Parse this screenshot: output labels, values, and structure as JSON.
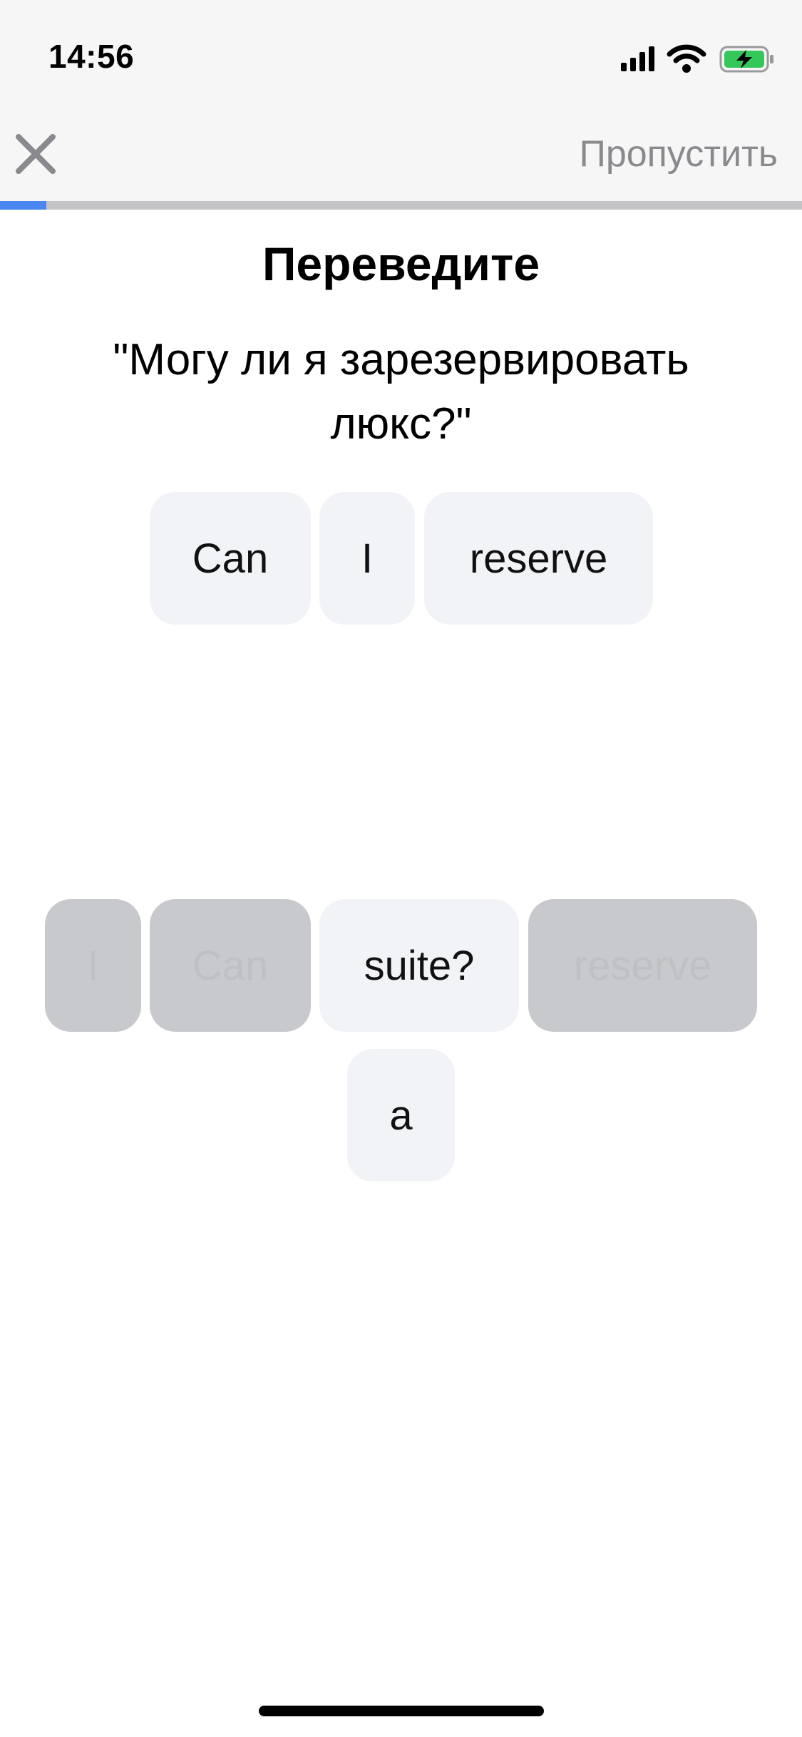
{
  "status_bar": {
    "time": "14:56",
    "battery_color": "#34c759"
  },
  "nav": {
    "close_icon": "close-icon",
    "skip_label": "Пропустить"
  },
  "progress": {
    "fraction": 0.058,
    "fill_color": "#4a86f0"
  },
  "exercise": {
    "instruction": "Переведите",
    "prompt": "\"Могу ли я зарезервировать люкс?\""
  },
  "answer_words": [
    "Can",
    "I",
    "reserve"
  ],
  "word_bank": [
    {
      "word": "I",
      "used": true
    },
    {
      "word": "Can",
      "used": true
    },
    {
      "word": "suite?",
      "used": false
    },
    {
      "word": "reserve",
      "used": true
    },
    {
      "word": "a",
      "used": false
    }
  ]
}
